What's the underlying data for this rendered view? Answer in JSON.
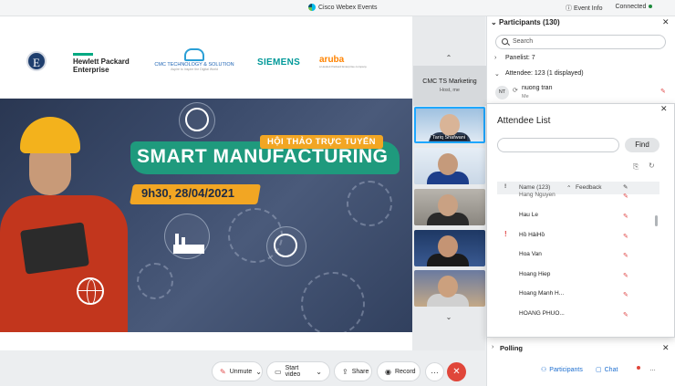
{
  "titlebar": {
    "app_title": "Cisco Webex Events",
    "event_info": "Event Info",
    "status": "Connected"
  },
  "slide": {
    "logos": {
      "e": "E",
      "hpe_line1": "Hewlett Packard",
      "hpe_line2": "Enterprise",
      "cmc": "CMC TECHNOLOGY & SOLUTION",
      "cmc_sub": "Aspire to Inspire the Digital World",
      "siemens": "SIEMENS",
      "aruba": "aruba",
      "aruba_sub": "a Hewlett Packard Enterprise company"
    },
    "kicker": "HỘI THẢO TRỰC TUYẾN",
    "title": "SMART MANUFACTURING",
    "date": "9h30, 28/04/2021"
  },
  "stage": {
    "label": "CMC TS Marketing",
    "sub": "Host, me"
  },
  "videos": [
    {
      "name": "Tariq Shafwani"
    },
    {
      "name": ""
    },
    {
      "name": ""
    },
    {
      "name": ""
    },
    {
      "name": ""
    }
  ],
  "participants": {
    "header": "Participants (130)",
    "search_placeholder": "Search",
    "panelist": "Panelist: 7",
    "attendee": "Attendee: 123 (1 displayed)",
    "me_initials": "NT",
    "me_name": "nuong tran",
    "me_sub": "Me"
  },
  "attendee_list": {
    "title": "Attendee List",
    "find_label": "Find",
    "col_name": "Name (123)",
    "col_feedback": "Feedback",
    "rows": [
      "Hang Nguyen",
      "Hau Le",
      "Hồ HảiHồ",
      "Hoa Van",
      "Hoang Hiep",
      "Hoang Manh H...",
      "HOANG PHUO..."
    ]
  },
  "polling": "Polling",
  "toolbar": {
    "unmute": "Unmute",
    "start_video": "Start video",
    "share": "Share",
    "record": "Record",
    "participants": "Participants",
    "chat": "Chat"
  },
  "colors": {
    "accent": "#1e6fd0",
    "end_call": "#e0463a",
    "headline": "#1f9a7d",
    "date_bar": "#f2a623"
  }
}
